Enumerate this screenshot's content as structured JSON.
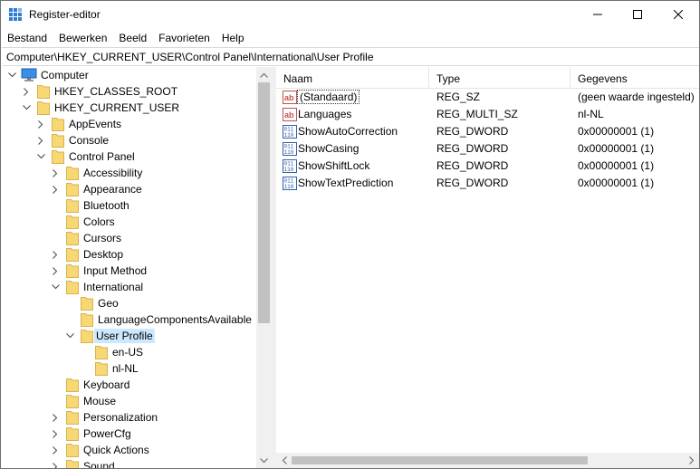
{
  "window": {
    "title": "Register-editor",
    "controls": {
      "minimize": "minimize-icon",
      "maximize": "maximize-icon",
      "close": "close-icon"
    }
  },
  "menu": [
    "Bestand",
    "Bewerken",
    "Beeld",
    "Favorieten",
    "Help"
  ],
  "address": "Computer\\HKEY_CURRENT_USER\\Control Panel\\International\\User Profile",
  "tree": {
    "root": "Computer",
    "items": [
      {
        "label": "HKEY_CLASSES_ROOT"
      },
      {
        "label": "HKEY_CURRENT_USER"
      },
      {
        "label": "AppEvents"
      },
      {
        "label": "Console"
      },
      {
        "label": "Control Panel"
      },
      {
        "label": "Accessibility"
      },
      {
        "label": "Appearance"
      },
      {
        "label": "Bluetooth"
      },
      {
        "label": "Colors"
      },
      {
        "label": "Cursors"
      },
      {
        "label": "Desktop"
      },
      {
        "label": "Input Method"
      },
      {
        "label": "International"
      },
      {
        "label": "Geo"
      },
      {
        "label": "LanguageComponentsAvailable"
      },
      {
        "label": "User Profile"
      },
      {
        "label": "en-US"
      },
      {
        "label": "nl-NL"
      },
      {
        "label": "Keyboard"
      },
      {
        "label": "Mouse"
      },
      {
        "label": "Personalization"
      },
      {
        "label": "PowerCfg"
      },
      {
        "label": "Quick Actions"
      },
      {
        "label": "Sound"
      }
    ]
  },
  "list": {
    "columns": [
      "Naam",
      "Type",
      "Gegevens"
    ],
    "rows": [
      {
        "icon": "string-value-icon",
        "name": "(Standaard)",
        "type": "REG_SZ",
        "data": "(geen waarde ingesteld)"
      },
      {
        "icon": "string-value-icon",
        "name": "Languages",
        "type": "REG_MULTI_SZ",
        "data": "nl-NL"
      },
      {
        "icon": "binary-value-icon",
        "name": "ShowAutoCorrection",
        "type": "REG_DWORD",
        "data": "0x00000001 (1)"
      },
      {
        "icon": "binary-value-icon",
        "name": "ShowCasing",
        "type": "REG_DWORD",
        "data": "0x00000001 (1)"
      },
      {
        "icon": "binary-value-icon",
        "name": "ShowShiftLock",
        "type": "REG_DWORD",
        "data": "0x00000001 (1)"
      },
      {
        "icon": "binary-value-icon",
        "name": "ShowTextPrediction",
        "type": "REG_DWORD",
        "data": "0x00000001 (1)"
      }
    ]
  },
  "colors": {
    "selection": "#cce8ff",
    "folder": "#f8d775",
    "scroll_thumb": "#c1c1c1",
    "scroll_track": "#f0f0f0"
  }
}
